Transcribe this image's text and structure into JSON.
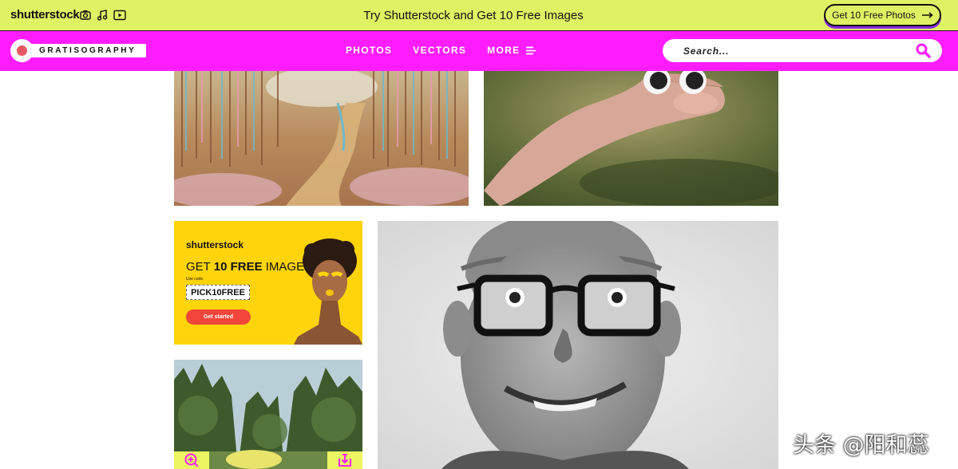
{
  "promo_bar": {
    "logo": "shutterstock",
    "icons": [
      "camera-icon",
      "music-note-icon",
      "video-play-icon"
    ],
    "text": "Try Shutterstock and Get 10 Free Images",
    "button_label": "Get 10 Free Photos",
    "background": "#dff264"
  },
  "nav": {
    "brand_name": "GRATISOGRAPHY",
    "links": [
      "PHOTOS",
      "VECTORS",
      "MORE"
    ],
    "search_placeholder": "Search...",
    "background": "#ff1dff"
  },
  "photos": [
    {
      "subject": "painted forest path"
    },
    {
      "subject": "hand with googly eyes"
    },
    {
      "subject": "man with glasses smiling"
    },
    {
      "subject": "trees and yellow car"
    }
  ],
  "ad": {
    "logo": "shutterstock",
    "headline_plain": "GET ",
    "headline_bold": "10 FREE",
    "headline_tail": " IMAGES",
    "use_code_label": "Use code",
    "code": "PICK10FREE",
    "cta": "Get started",
    "background": "#ffd40a"
  },
  "tile_actions": {
    "zoom": "zoom-in-icon",
    "download": "download-icon"
  },
  "watermark": "头条 @阳和蕊"
}
